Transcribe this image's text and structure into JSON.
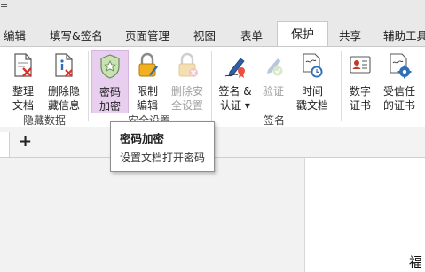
{
  "tabs": [
    {
      "label": "编辑"
    },
    {
      "label": "填写&签名"
    },
    {
      "label": "页面管理"
    },
    {
      "label": "视图"
    },
    {
      "label": "表单"
    },
    {
      "label": "保护"
    },
    {
      "label": "共享"
    },
    {
      "label": "辅助工具"
    }
  ],
  "active_tab": "保护",
  "left_edge_mark": "=",
  "ribbon": {
    "groups": [
      {
        "label": "隐藏数据",
        "buttons": [
          {
            "label": "整理\n文档",
            "icon": "doc-clean-icon"
          },
          {
            "label": "删除隐\n藏信息",
            "icon": "remove-hidden-info-icon"
          }
        ]
      },
      {
        "label": "安全设置",
        "buttons": [
          {
            "label": "密码\n加密",
            "icon": "password-shield-icon",
            "state": "hover"
          },
          {
            "label": "限制\n编辑",
            "icon": "lock-edit-icon"
          },
          {
            "label": "删除安\n全设置",
            "icon": "remove-security-icon",
            "state": "disabled"
          }
        ]
      },
      {
        "label": "签名",
        "buttons": [
          {
            "label": "签名 &\n认证 ▾",
            "icon": "sign-pen-icon"
          },
          {
            "label": "验证",
            "icon": "verify-icon",
            "state": "disabled"
          },
          {
            "label": "时间\n戳文档",
            "icon": "timestamp-icon"
          }
        ]
      },
      {
        "label": "",
        "buttons": [
          {
            "label": "数字\n证书",
            "icon": "certificate-icon"
          },
          {
            "label": "受信任\n的证书",
            "icon": "trusted-cert-icon"
          }
        ]
      }
    ]
  },
  "tooltip": {
    "title": "密码加密",
    "description": "设置文档打开密码"
  },
  "doc_tabs": {
    "add_label": "+"
  },
  "page_text": "福"
}
